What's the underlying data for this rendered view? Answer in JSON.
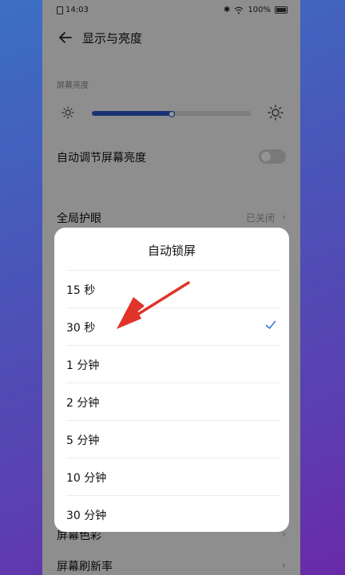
{
  "status_bar": {
    "time": "14:03",
    "battery": "100%"
  },
  "header": {
    "title": "显示与亮度"
  },
  "brightness": {
    "section_label": "屏幕亮度",
    "level": 0.52
  },
  "auto_brightness": {
    "label": "自动调节屏幕亮度",
    "enabled": false
  },
  "eye_comfort": {
    "label": "全局护眼",
    "value": "已关闭"
  },
  "behind_rows": {
    "color": "屏幕色彩",
    "refresh": "屏幕刷新率"
  },
  "dialog": {
    "title": "自动锁屏",
    "selected_index": 1,
    "options": [
      "15 秒",
      "30 秒",
      "1 分钟",
      "2 分钟",
      "5 分钟",
      "10 分钟",
      "30 分钟"
    ]
  },
  "colors": {
    "accent": "#2b55c9",
    "annotation_arrow": "#e0342a",
    "check": "#3b74d6"
  },
  "annotation": {
    "icon": "red-arrow-pointing-at-30-seconds"
  }
}
